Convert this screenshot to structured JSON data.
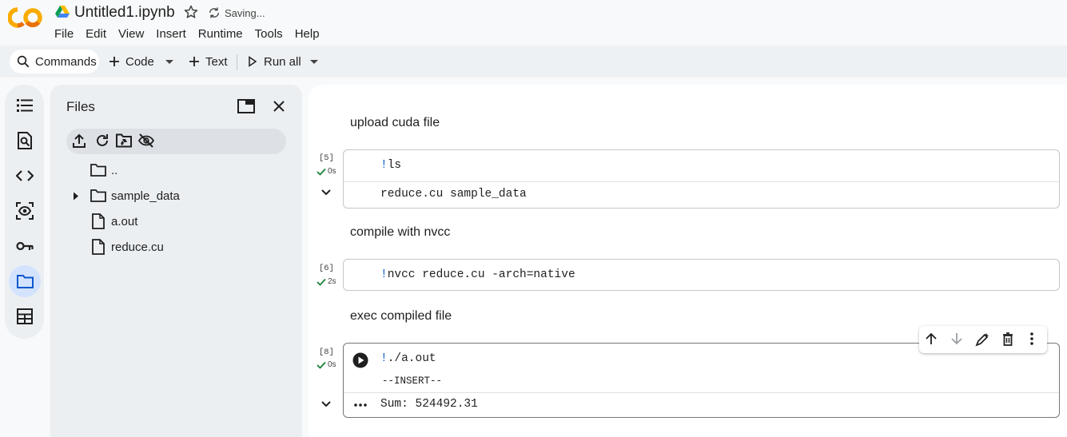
{
  "app": {
    "notebook_title": "Untitled1.ipynb",
    "save_status": "Saving..."
  },
  "menu": [
    "File",
    "Edit",
    "View",
    "Insert",
    "Runtime",
    "Tools",
    "Help"
  ],
  "toolbar": {
    "commands_label": "Commands",
    "code_label": "Code",
    "text_label": "Text",
    "run_all_label": "Run all"
  },
  "rail": {
    "items": [
      "table-of-contents-icon",
      "find-icon",
      "code-snippets-icon",
      "variables-icon",
      "secrets-key-icon",
      "files-folder-icon",
      "data-table-icon"
    ],
    "active": "files-folder-icon"
  },
  "files": {
    "title": "Files",
    "entries": [
      {
        "name": "..",
        "type": "folder",
        "expandable": false
      },
      {
        "name": "sample_data",
        "type": "folder",
        "expandable": true
      },
      {
        "name": "a.out",
        "type": "file",
        "expandable": false
      },
      {
        "name": "reduce.cu",
        "type": "file",
        "expandable": false
      }
    ]
  },
  "notebook": {
    "cells": [
      {
        "kind": "text",
        "text": "upload cuda file"
      },
      {
        "kind": "code",
        "exec_count": "[5]",
        "exec_time": "0s",
        "code_prefix": "!",
        "code": "ls",
        "output": "reduce.cu  sample_data"
      },
      {
        "kind": "text",
        "text": "compile with nvcc"
      },
      {
        "kind": "code",
        "exec_count": "[6]",
        "exec_time": "2s",
        "code_prefix": "!",
        "code": "nvcc reduce.cu -arch=native",
        "output": ""
      },
      {
        "kind": "text",
        "text": "exec compiled file"
      },
      {
        "kind": "code",
        "exec_count": "[8]",
        "exec_time": "0s",
        "code_prefix": "!",
        "code": "./a.out",
        "mode": "--INSERT--",
        "output": "Sum: 524492.31"
      }
    ]
  },
  "colors": {
    "accent": "#0b57d0",
    "success": "#188038",
    "logo_orange": "#f9ab00",
    "logo_dark_orange": "#e8710a"
  }
}
